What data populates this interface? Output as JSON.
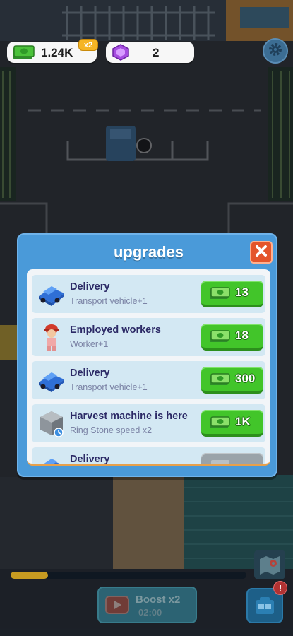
{
  "hud": {
    "cash_icon": "cash-stack-icon",
    "cash_value": "1.24K",
    "cash_multiplier": "x2",
    "gem_icon": "purple-gem-icon",
    "gem_value": "2",
    "settings_icon": "gear-icon"
  },
  "modal": {
    "title": "upgrades",
    "close_icon": "close-icon",
    "rows": [
      {
        "icon": "blue-truck-icon",
        "title": "Delivery",
        "subtitle": "Transport vehicle+1",
        "price": "13",
        "state": "available"
      },
      {
        "icon": "worker-icon",
        "title": "Employed workers",
        "subtitle": "Worker+1",
        "price": "18",
        "state": "available"
      },
      {
        "icon": "blue-truck-icon",
        "title": "Delivery",
        "subtitle": "Transport vehicle+1",
        "price": "300",
        "state": "available"
      },
      {
        "icon": "stone-machine-icon",
        "title": "Harvest machine is here",
        "subtitle": "Ring Stone speed x2",
        "price": "1K",
        "state": "available"
      },
      {
        "icon": "blue-truck-icon",
        "title": "Delivery",
        "subtitle": "",
        "price": "",
        "state": "locked"
      }
    ]
  },
  "bottom": {
    "progress": 0.16,
    "boost_label": "Boost x2",
    "boost_time": "02:00",
    "boost_icon": "video-ad-icon",
    "map_icon": "map-icon",
    "shop_icon": "shop-icon",
    "shop_badge": "!"
  },
  "colors": {
    "modal_blue": "#4a9ad9",
    "buy_green": "#42c52a",
    "close_red": "#e4552b",
    "title_navy": "#2c2a66"
  }
}
